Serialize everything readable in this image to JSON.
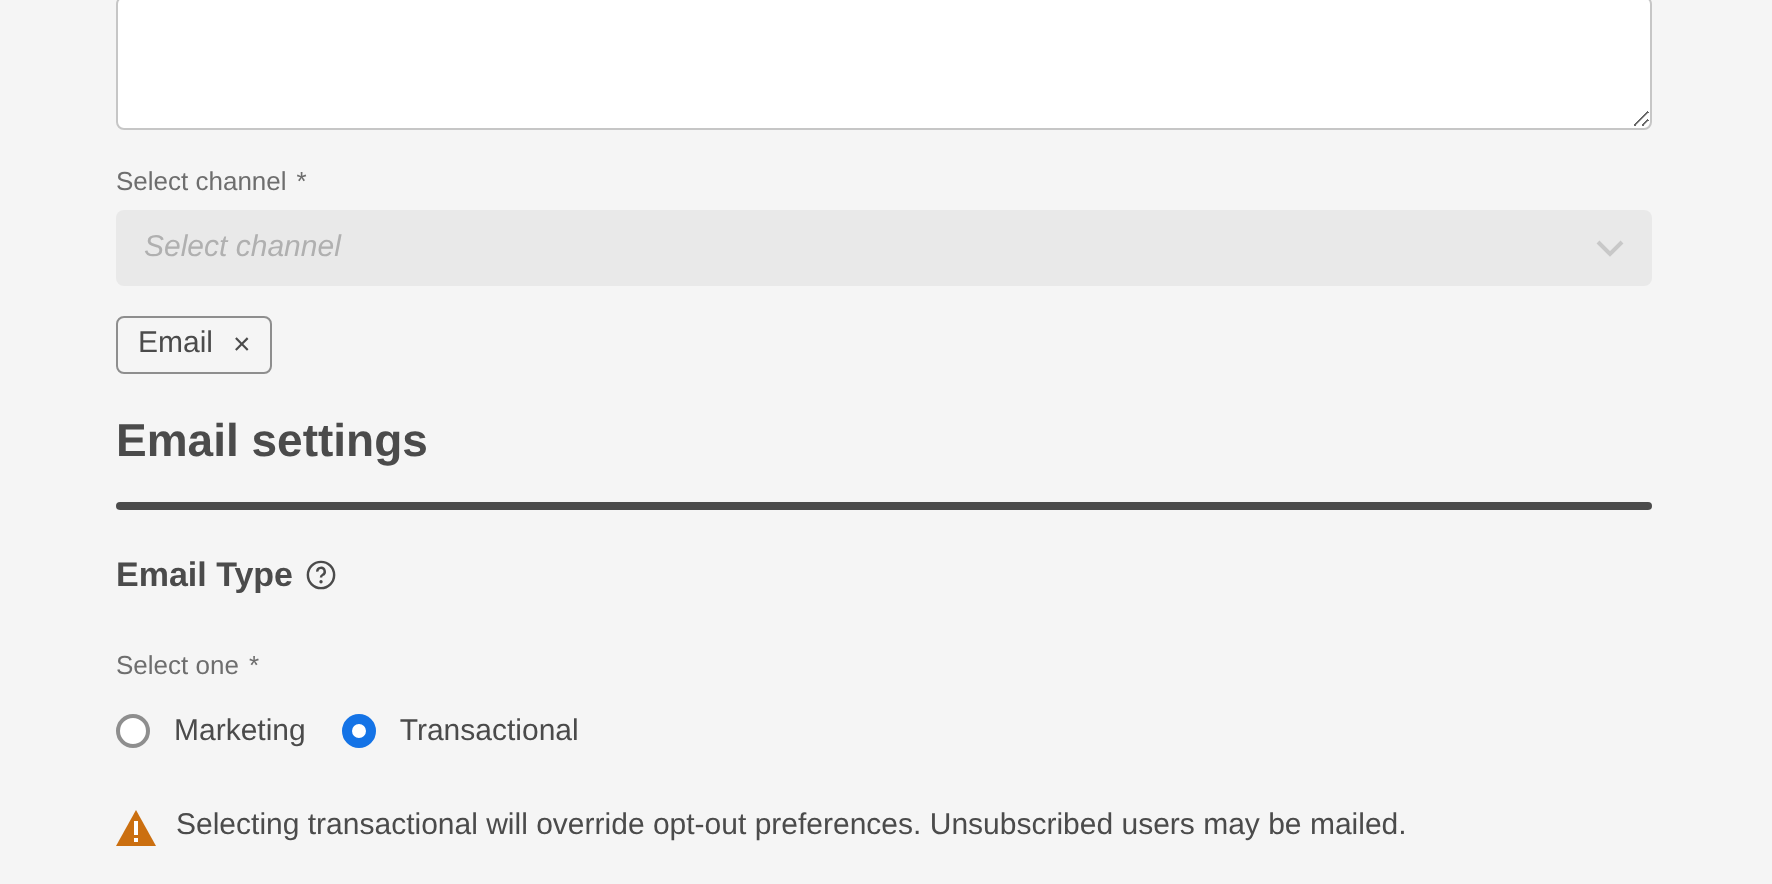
{
  "channel_field": {
    "label": "Select channel",
    "required_mark": "*",
    "placeholder": "Select channel",
    "disabled": true
  },
  "tags": [
    {
      "label": "Email",
      "remove": "×"
    }
  ],
  "section": {
    "title": "Email settings"
  },
  "email_type": {
    "title": "Email Type",
    "label": "Select one",
    "required_mark": "*",
    "options": [
      {
        "label": "Marketing",
        "selected": false
      },
      {
        "label": "Transactional",
        "selected": true
      }
    ],
    "warning": "Selecting transactional will override opt-out preferences. Unsubscribed users may be mailed."
  }
}
